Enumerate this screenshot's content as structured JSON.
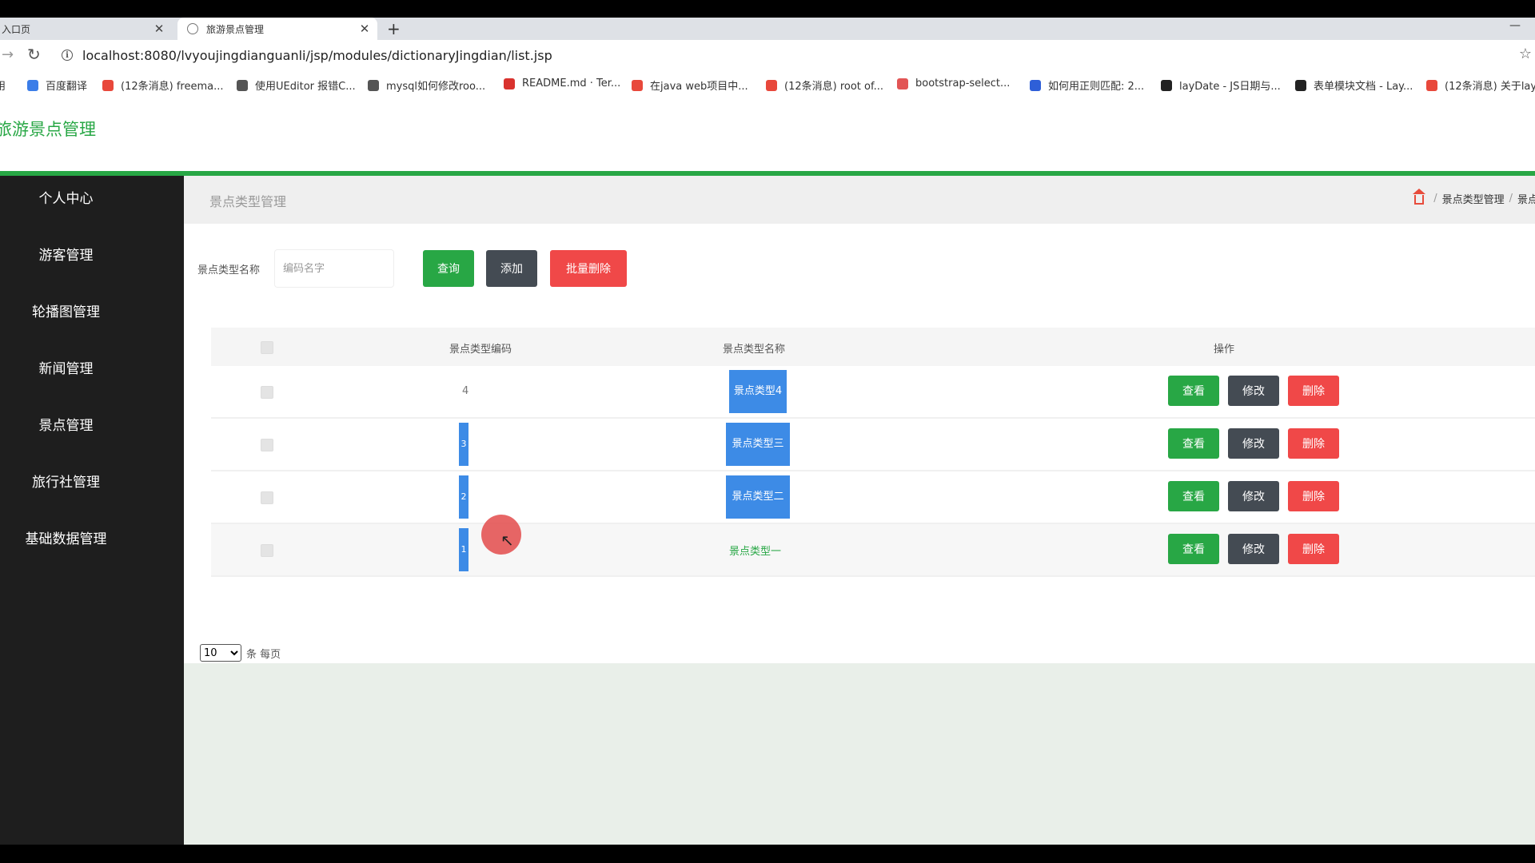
{
  "browser": {
    "tab1_title": "入口页",
    "tab2_title": "旅游景点管理",
    "close_glyph": "✕",
    "newtab_glyph": "+",
    "url": "localhost:8080/lvyoujingdianguanli/jsp/modules/dictionaryJingdian/list.jsp",
    "bookmarks": [
      {
        "label": "用",
        "icon": "apps-icon",
        "color": "#888888"
      },
      {
        "label": "百度翻译",
        "icon": "baidu-translate-icon",
        "color": "#3b7de8"
      },
      {
        "label": "(12条消息) freema...",
        "icon": "csdn-icon",
        "color": "#e8483b"
      },
      {
        "label": "使用UEditor 报错C...",
        "icon": "ueditor-icon",
        "color": "#555555"
      },
      {
        "label": "mysql如何修改roo...",
        "icon": "ueditor-icon",
        "color": "#555555"
      },
      {
        "label": "README.md · Ter...",
        "icon": "gitee-icon",
        "color": "#d9322e"
      },
      {
        "label": "在java web项目中...",
        "icon": "csdn-icon",
        "color": "#e8483b"
      },
      {
        "label": "(12条消息) root of...",
        "icon": "csdn-icon",
        "color": "#e8483b"
      },
      {
        "label": "bootstrap-select...",
        "icon": "bookmark-icon",
        "color": "#e25555"
      },
      {
        "label": "如何用正则匹配: 2...",
        "icon": "baidu-icon",
        "color": "#2e5fd8"
      },
      {
        "label": "layDate - JS日期与...",
        "icon": "layui-icon",
        "color": "#222222"
      },
      {
        "label": "表单模块文档 - Lay...",
        "icon": "layui-icon",
        "color": "#222222"
      },
      {
        "label": "(12条消息) 关于lay",
        "icon": "csdn-icon",
        "color": "#e8483b"
      }
    ]
  },
  "app": {
    "title": "旅游景点管理",
    "accent": "#28a745"
  },
  "sidebar": {
    "items": [
      "个人中心",
      "游客管理",
      "轮播图管理",
      "新闻管理",
      "景点管理",
      "旅行社管理",
      "基础数据管理"
    ]
  },
  "breadcrumb": {
    "page_title": "景点类型管理",
    "items": [
      "景点类型管理",
      "景点"
    ]
  },
  "search": {
    "label": "景点类型名称",
    "placeholder": "编码名字",
    "query_label": "查询",
    "add_label": "添加",
    "batch_delete_label": "批量删除"
  },
  "table": {
    "headers": [
      "景点类型编码",
      "景点类型名称",
      "操作"
    ],
    "rows": [
      {
        "code": "4",
        "name": "景点类型4"
      },
      {
        "code": "3",
        "name": "景点类型三"
      },
      {
        "code": "2",
        "name": "景点类型二"
      },
      {
        "code": "1",
        "name": "景点类型一"
      }
    ],
    "actions": [
      "查看",
      "修改",
      "删除"
    ]
  },
  "pager": {
    "page_size": "10",
    "suffix": "条 每页"
  }
}
